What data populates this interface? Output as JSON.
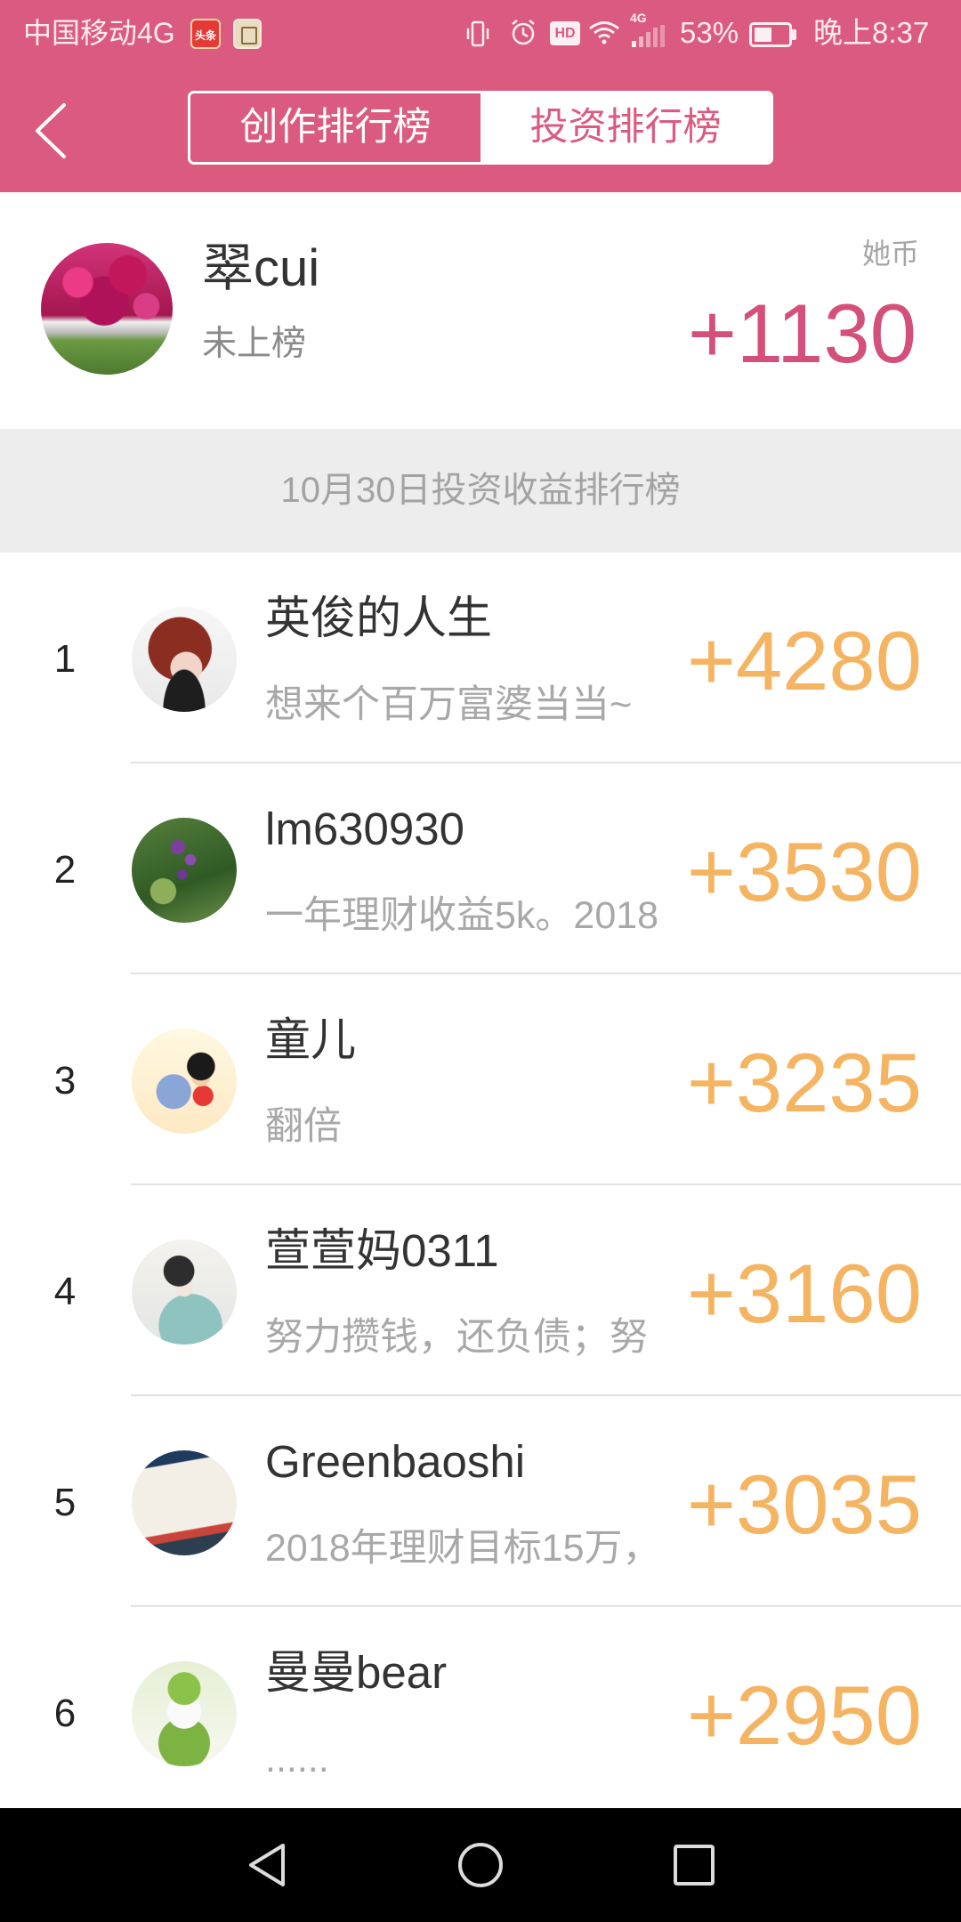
{
  "theme": {
    "accent": "#db5b80",
    "score_orange": "#f5b462",
    "my_score": "#d4507a"
  },
  "status_bar": {
    "carrier": "中国移动4G",
    "notification_badge": "头条",
    "hd_label": "HD",
    "network_type": "4G",
    "battery_percent": "53%",
    "time": "晚上8:37",
    "icons": [
      "app-notification-icon",
      "vibrate-icon",
      "alarm-icon",
      "wifi-icon",
      "signal-icon",
      "battery-icon"
    ]
  },
  "header": {
    "back_icon": "chevron-left-icon",
    "tabs": [
      {
        "label": "创作排行榜",
        "active": false
      },
      {
        "label": "投资排行榜",
        "active": true
      }
    ]
  },
  "me": {
    "name": "翠cui",
    "rank_status": "未上榜",
    "currency_label": "她币",
    "score": "+1130"
  },
  "section_title": "10月30日投资收益排行榜",
  "ranking": [
    {
      "rank": "1",
      "name": "英俊的人生",
      "motto": "想来个百万富婆当当~",
      "score": "+4280"
    },
    {
      "rank": "2",
      "name": "lm630930",
      "motto": "一年理财收益5k。2018",
      "score": "+3530"
    },
    {
      "rank": "3",
      "name": "童儿",
      "motto": "翻倍",
      "score": "+3235"
    },
    {
      "rank": "4",
      "name": "萱萱妈0311",
      "motto": "努力攒钱，还负债；努",
      "score": "+3160"
    },
    {
      "rank": "5",
      "name": "Greenbaoshi",
      "motto": "2018年理财目标15万，",
      "score": "+3035"
    },
    {
      "rank": "6",
      "name": "曼曼bear",
      "motto": "......",
      "score": "+2950"
    }
  ],
  "nav_bar": {
    "icons": [
      "back-triangle-icon",
      "home-circle-icon",
      "recents-square-icon"
    ]
  }
}
